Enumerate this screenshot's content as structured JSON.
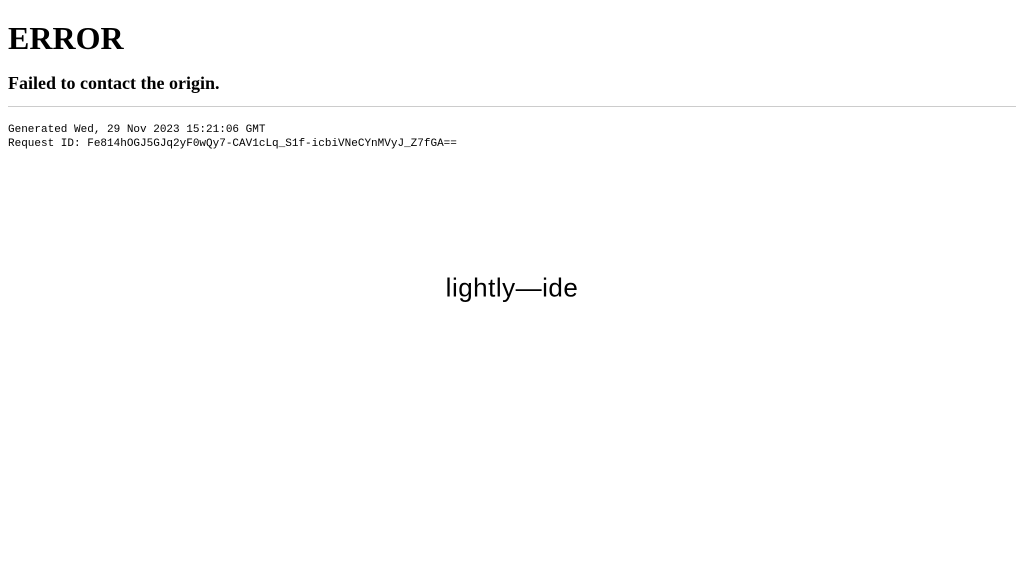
{
  "error": {
    "title": "ERROR",
    "message": "Failed to contact the origin."
  },
  "meta": {
    "generated_line": "Generated Wed, 29 Nov 2023 15:21:06 GMT",
    "request_id_line": "Request ID: Fe814hOGJ5GJq2yF0wQy7-CAV1cLq_S1f-icbiVNeCYnMVyJ_Z7fGA=="
  },
  "brand": {
    "name": "lightly—ide"
  }
}
